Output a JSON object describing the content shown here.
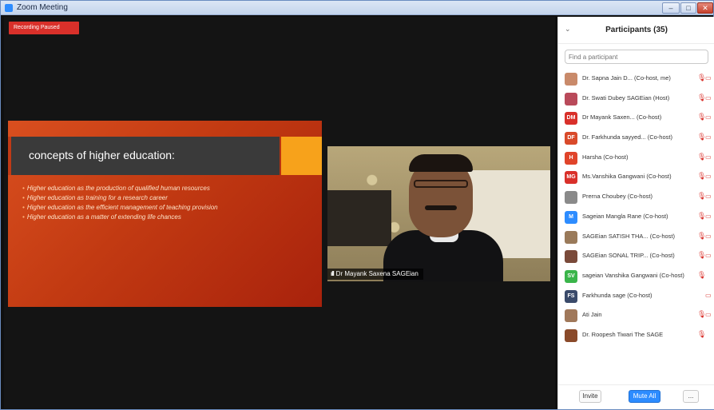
{
  "window": {
    "title": "Zoom Meeting"
  },
  "recording": {
    "status": "Recording Paused"
  },
  "slide": {
    "heading": "concepts of higher education:",
    "bullets": [
      "Higher education as the production of qualified human resources",
      "Higher education as training for a research career",
      "Higher education as the efficient management of teaching provision",
      "Higher education as a matter of extending life chances"
    ]
  },
  "video": {
    "speaker_label": "Dr Mayank Saxena SAGEian"
  },
  "participants": {
    "title": "Participants (35)",
    "search_placeholder": "Find a participant",
    "list": [
      {
        "initials": "",
        "color": "#c98a6a",
        "name": "Dr. Sapna Jain D... (Co-host, me)",
        "mic": "🎙",
        "cam": "▭"
      },
      {
        "initials": "",
        "color": "#b94a5a",
        "name": "Dr. Swati Dubey SAGEian (Host)",
        "mic": "🎙",
        "cam": "▭"
      },
      {
        "initials": "DM",
        "color": "#d9302a",
        "name": "Dr Mayank Saxen... (Co-host)",
        "mic": "🎙",
        "cam": "▭"
      },
      {
        "initials": "DF",
        "color": "#d94a2a",
        "name": "Dr. Farkhunda sayyed... (Co-host)",
        "mic": "🎙",
        "cam": "▭"
      },
      {
        "initials": "H",
        "color": "#e0442a",
        "name": "Harsha (Co-host)",
        "mic": "🎙",
        "cam": "▭"
      },
      {
        "initials": "MG",
        "color": "#d9302a",
        "name": "Ms.Vanshika Gangwani (Co-host)",
        "mic": "🎙",
        "cam": "▭"
      },
      {
        "initials": "",
        "color": "#8a8a8a",
        "name": "Prerna Choubey (Co-host)",
        "mic": "🎙",
        "cam": "▭"
      },
      {
        "initials": "M",
        "color": "#2d8cff",
        "name": "Sageian Mangla Rane (Co-host)",
        "mic": "🎙",
        "cam": "▭"
      },
      {
        "initials": "",
        "color": "#9a7a5a",
        "name": "SAGEian SATISH THA... (Co-host)",
        "mic": "🎙",
        "cam": "▭"
      },
      {
        "initials": "",
        "color": "#7a4a3a",
        "name": "SAGEian SONAL TRIP... (Co-host)",
        "mic": "🎙",
        "cam": "▭"
      },
      {
        "initials": "SV",
        "color": "#3ab54a",
        "name": "sageian Vanshika Gangwani (Co-host)",
        "mic": "🎙",
        "cam": ""
      },
      {
        "initials": "FS",
        "color": "#3a4a6a",
        "name": "Farkhunda sage (Co-host)",
        "mic": "",
        "cam": "▭"
      },
      {
        "initials": "",
        "color": "#a0785a",
        "name": "Ati Jain",
        "mic": "🎙",
        "cam": "▭"
      },
      {
        "initials": "",
        "color": "#8a4a2a",
        "name": "Dr. Roopesh Tiwari The SAGE",
        "mic": "🎙",
        "cam": ""
      }
    ],
    "buttons": {
      "invite": "Invite",
      "mute_all": "Mute All",
      "more": "..."
    }
  }
}
